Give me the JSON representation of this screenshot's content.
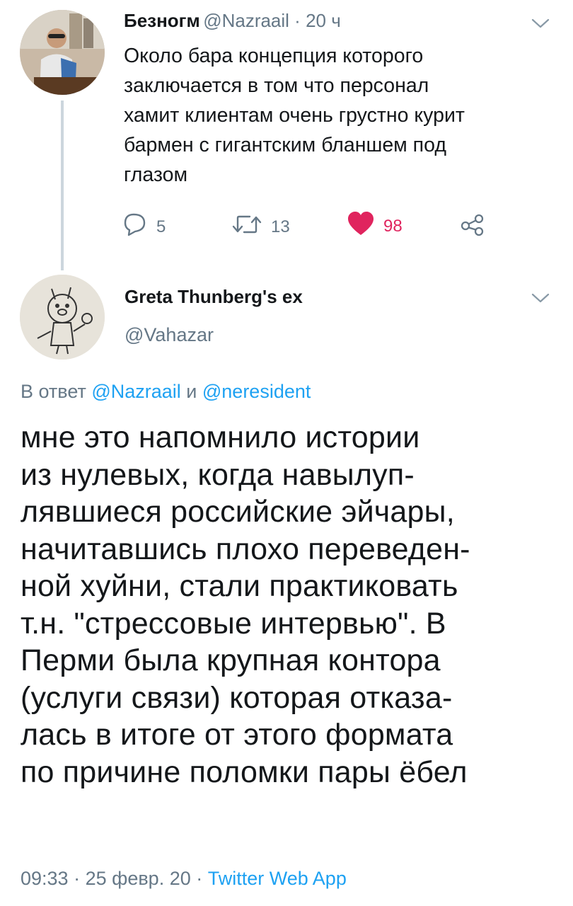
{
  "tweet1": {
    "display_name": "Безногм",
    "handle": "@Nazraail",
    "separator": " · ",
    "time_ago": "20 ч",
    "text": "Около бара концепция которого\nзаключается в том что персонал\nхамит клиентам  очень грустно курит\nбармен с гигантским бланшем под\nглазом",
    "actions": {
      "replies": "5",
      "retweets": "13",
      "likes": "98"
    }
  },
  "tweet2": {
    "display_name": "Greta Thunberg's ex",
    "handle": "@Vahazar",
    "reply_prefix": "В ответ ",
    "reply_user1": "@Nazraail",
    "reply_and": " и ",
    "reply_user2": "@neresident",
    "text": "мне это напомнило истории\nиз нулевых, когда навылуп-\nлявшиеся российские эйчары,\nначитавшись плохо переведен-\nной хуйни, стали практиковать\nт.н. \"стрессовые интервью\". В\nПерми была крупная контора\n(услуги связи) которая отказа-\nлась в итоге от этого формата\nпо причине поломки пары ёбел",
    "time": "09:33",
    "sep1": " · ",
    "date": "25 февр. 20",
    "sep2": " · ",
    "source": "Twitter Web App"
  },
  "colors": {
    "link": "#1da1f2",
    "muted": "#657786",
    "like": "#e0245e",
    "text": "#14171a"
  },
  "icons": [
    "chevron-down-icon",
    "reply-icon",
    "retweet-icon",
    "heart-icon",
    "share-icon"
  ]
}
